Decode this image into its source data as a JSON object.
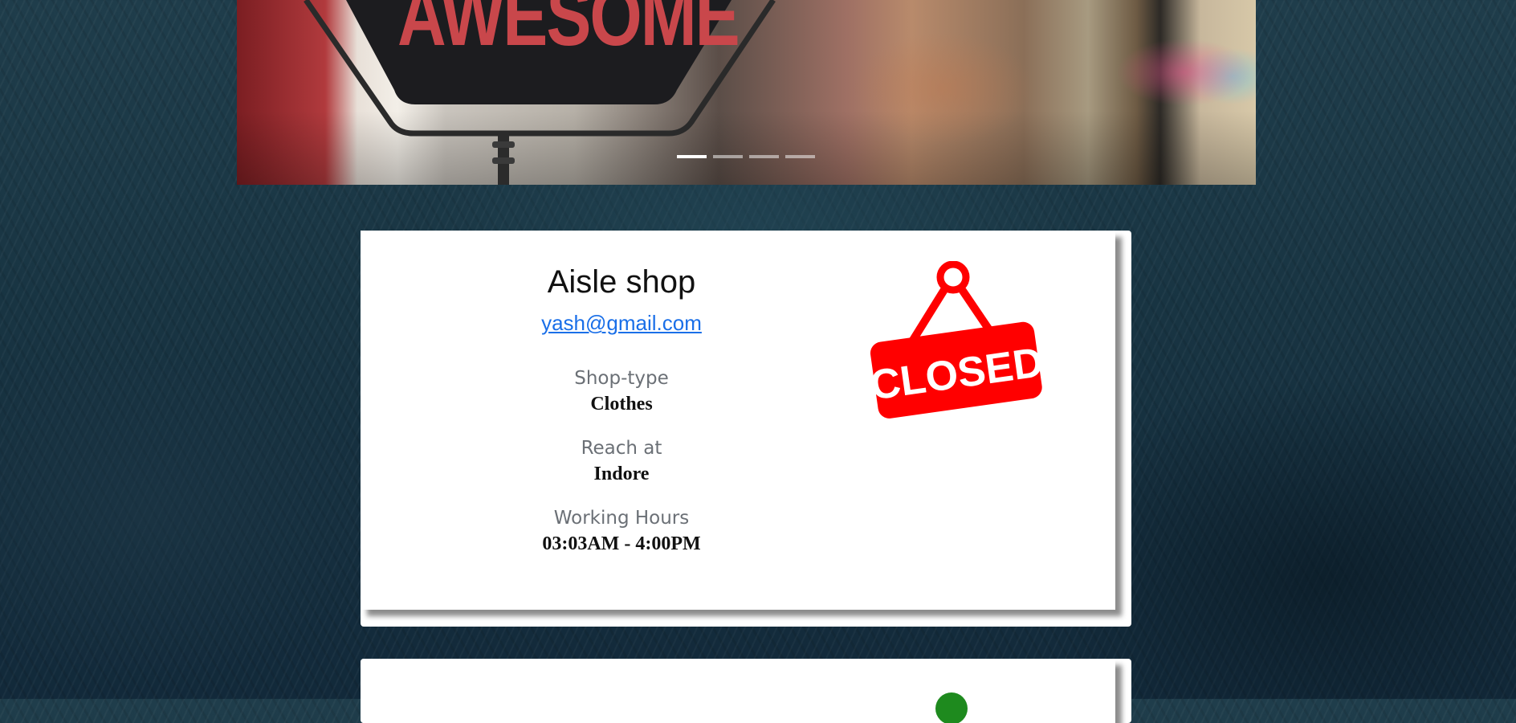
{
  "carousel": {
    "sign_text": "AWESOME",
    "indicators": [
      {
        "active": true
      },
      {
        "active": false
      },
      {
        "active": false
      },
      {
        "active": false
      }
    ]
  },
  "shop": {
    "name": "Aisle shop",
    "email": "yash@gmail.com",
    "shop_type_label": "Shop-type",
    "shop_type": "Clothes",
    "reach_label": "Reach at",
    "reach": "Indore",
    "hours_label": "Working Hours",
    "hours": "03:03AM - 4:00PM",
    "status_sign": "CLOSED",
    "status_color": "#ff0000"
  },
  "next_card": {
    "status_color": "#1e8a1e"
  },
  "colors": {
    "link": "#1a6fe8",
    "label": "#6b7076"
  }
}
